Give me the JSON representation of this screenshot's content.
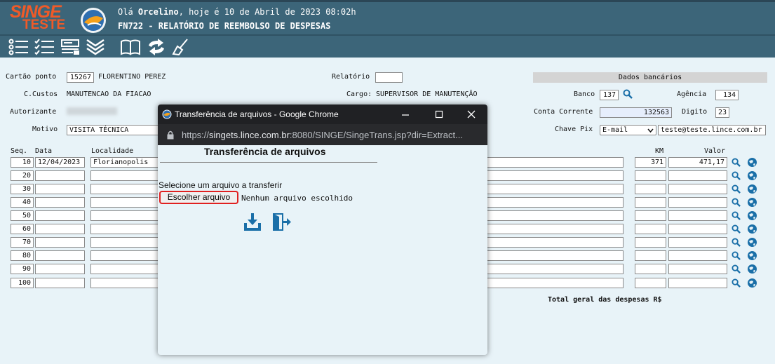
{
  "header": {
    "logo_top": "SINGE",
    "logo_bottom": "TESTE",
    "greeting_prefix": "Olá ",
    "user": "Orcelino",
    "greeting_suffix": ", hoje é 10 de Abril de 2023 08:02h",
    "report_title": "FN722 - RELATÓRIO DE REEMBOLSO DE DESPESAS"
  },
  "toolbar": {
    "icons": [
      "list-icon",
      "checklist-icon",
      "form-icon",
      "chevrons-down-icon",
      "book-icon",
      "refresh-icon",
      "broom-icon"
    ]
  },
  "form": {
    "cartao_label": "Cartão ponto",
    "cartao_value": "15267",
    "cartao_name": "FLORENTINO PEREZ",
    "relatorio_label": "Relatório",
    "relatorio_value": "",
    "ccustos_label": "C.Custos",
    "ccustos_value": "MANUTENCAO DA FIACAO",
    "cargo_label": "Cargo:",
    "cargo_value": "SUPERVISOR DE MANUTENÇÃO",
    "autorizante_label": "Autorizante",
    "autorizante_value": "",
    "motivo_label": "Motivo",
    "motivo_value": "VISITA TÉCNICA"
  },
  "bank": {
    "title": "Dados bancários",
    "banco_label": "Banco",
    "banco_value": "137",
    "agencia_label": "Agência",
    "agencia_value": "134",
    "conta_label": "Conta Corrente",
    "conta_value": "132563",
    "digito_label": "Digito",
    "digito_value": "23",
    "chave_label": "Chave Pix",
    "chave_type": "E-mail",
    "chave_value": "teste@teste.lince.com.br"
  },
  "table": {
    "headers": {
      "seq": "Seq.",
      "data": "Data",
      "localidade": "Localidade",
      "km": "KM",
      "valor": "Valor"
    },
    "rows": [
      {
        "seq": "10",
        "data": "12/04/2023",
        "localidade": "Florianopolis",
        "km": "371",
        "valor": "471,17"
      },
      {
        "seq": "20",
        "data": "",
        "localidade": "",
        "km": "",
        "valor": ""
      },
      {
        "seq": "30",
        "data": "",
        "localidade": "",
        "km": "",
        "valor": ""
      },
      {
        "seq": "40",
        "data": "",
        "localidade": "",
        "km": "",
        "valor": ""
      },
      {
        "seq": "50",
        "data": "",
        "localidade": "",
        "km": "",
        "valor": ""
      },
      {
        "seq": "60",
        "data": "",
        "localidade": "",
        "km": "",
        "valor": ""
      },
      {
        "seq": "70",
        "data": "",
        "localidade": "",
        "km": "",
        "valor": ""
      },
      {
        "seq": "80",
        "data": "",
        "localidade": "",
        "km": "",
        "valor": ""
      },
      {
        "seq": "90",
        "data": "",
        "localidade": "",
        "km": "",
        "valor": ""
      },
      {
        "seq": "100",
        "data": "",
        "localidade": "",
        "km": "",
        "valor": ""
      }
    ],
    "total_label": "Total geral das despesas R$"
  },
  "modal": {
    "window_title": "Transferência de arquivos - Google Chrome",
    "url_prefix": "https://",
    "url_host": "singets.lince.com.br",
    "url_rest": ":8080/SINGE/SingeTrans.jsp?dir=Extract...",
    "heading": "Transferência de arquivos",
    "select_label": "Selecione um arquivo a transferir",
    "file_button": "Escolher arquivo",
    "no_file": "Nenhum arquivo escolhido"
  },
  "colors": {
    "header_bg": "#3c6579",
    "logo": "#f05a28",
    "icon_blue": "#1a6fa8",
    "highlight": "#e02020"
  }
}
